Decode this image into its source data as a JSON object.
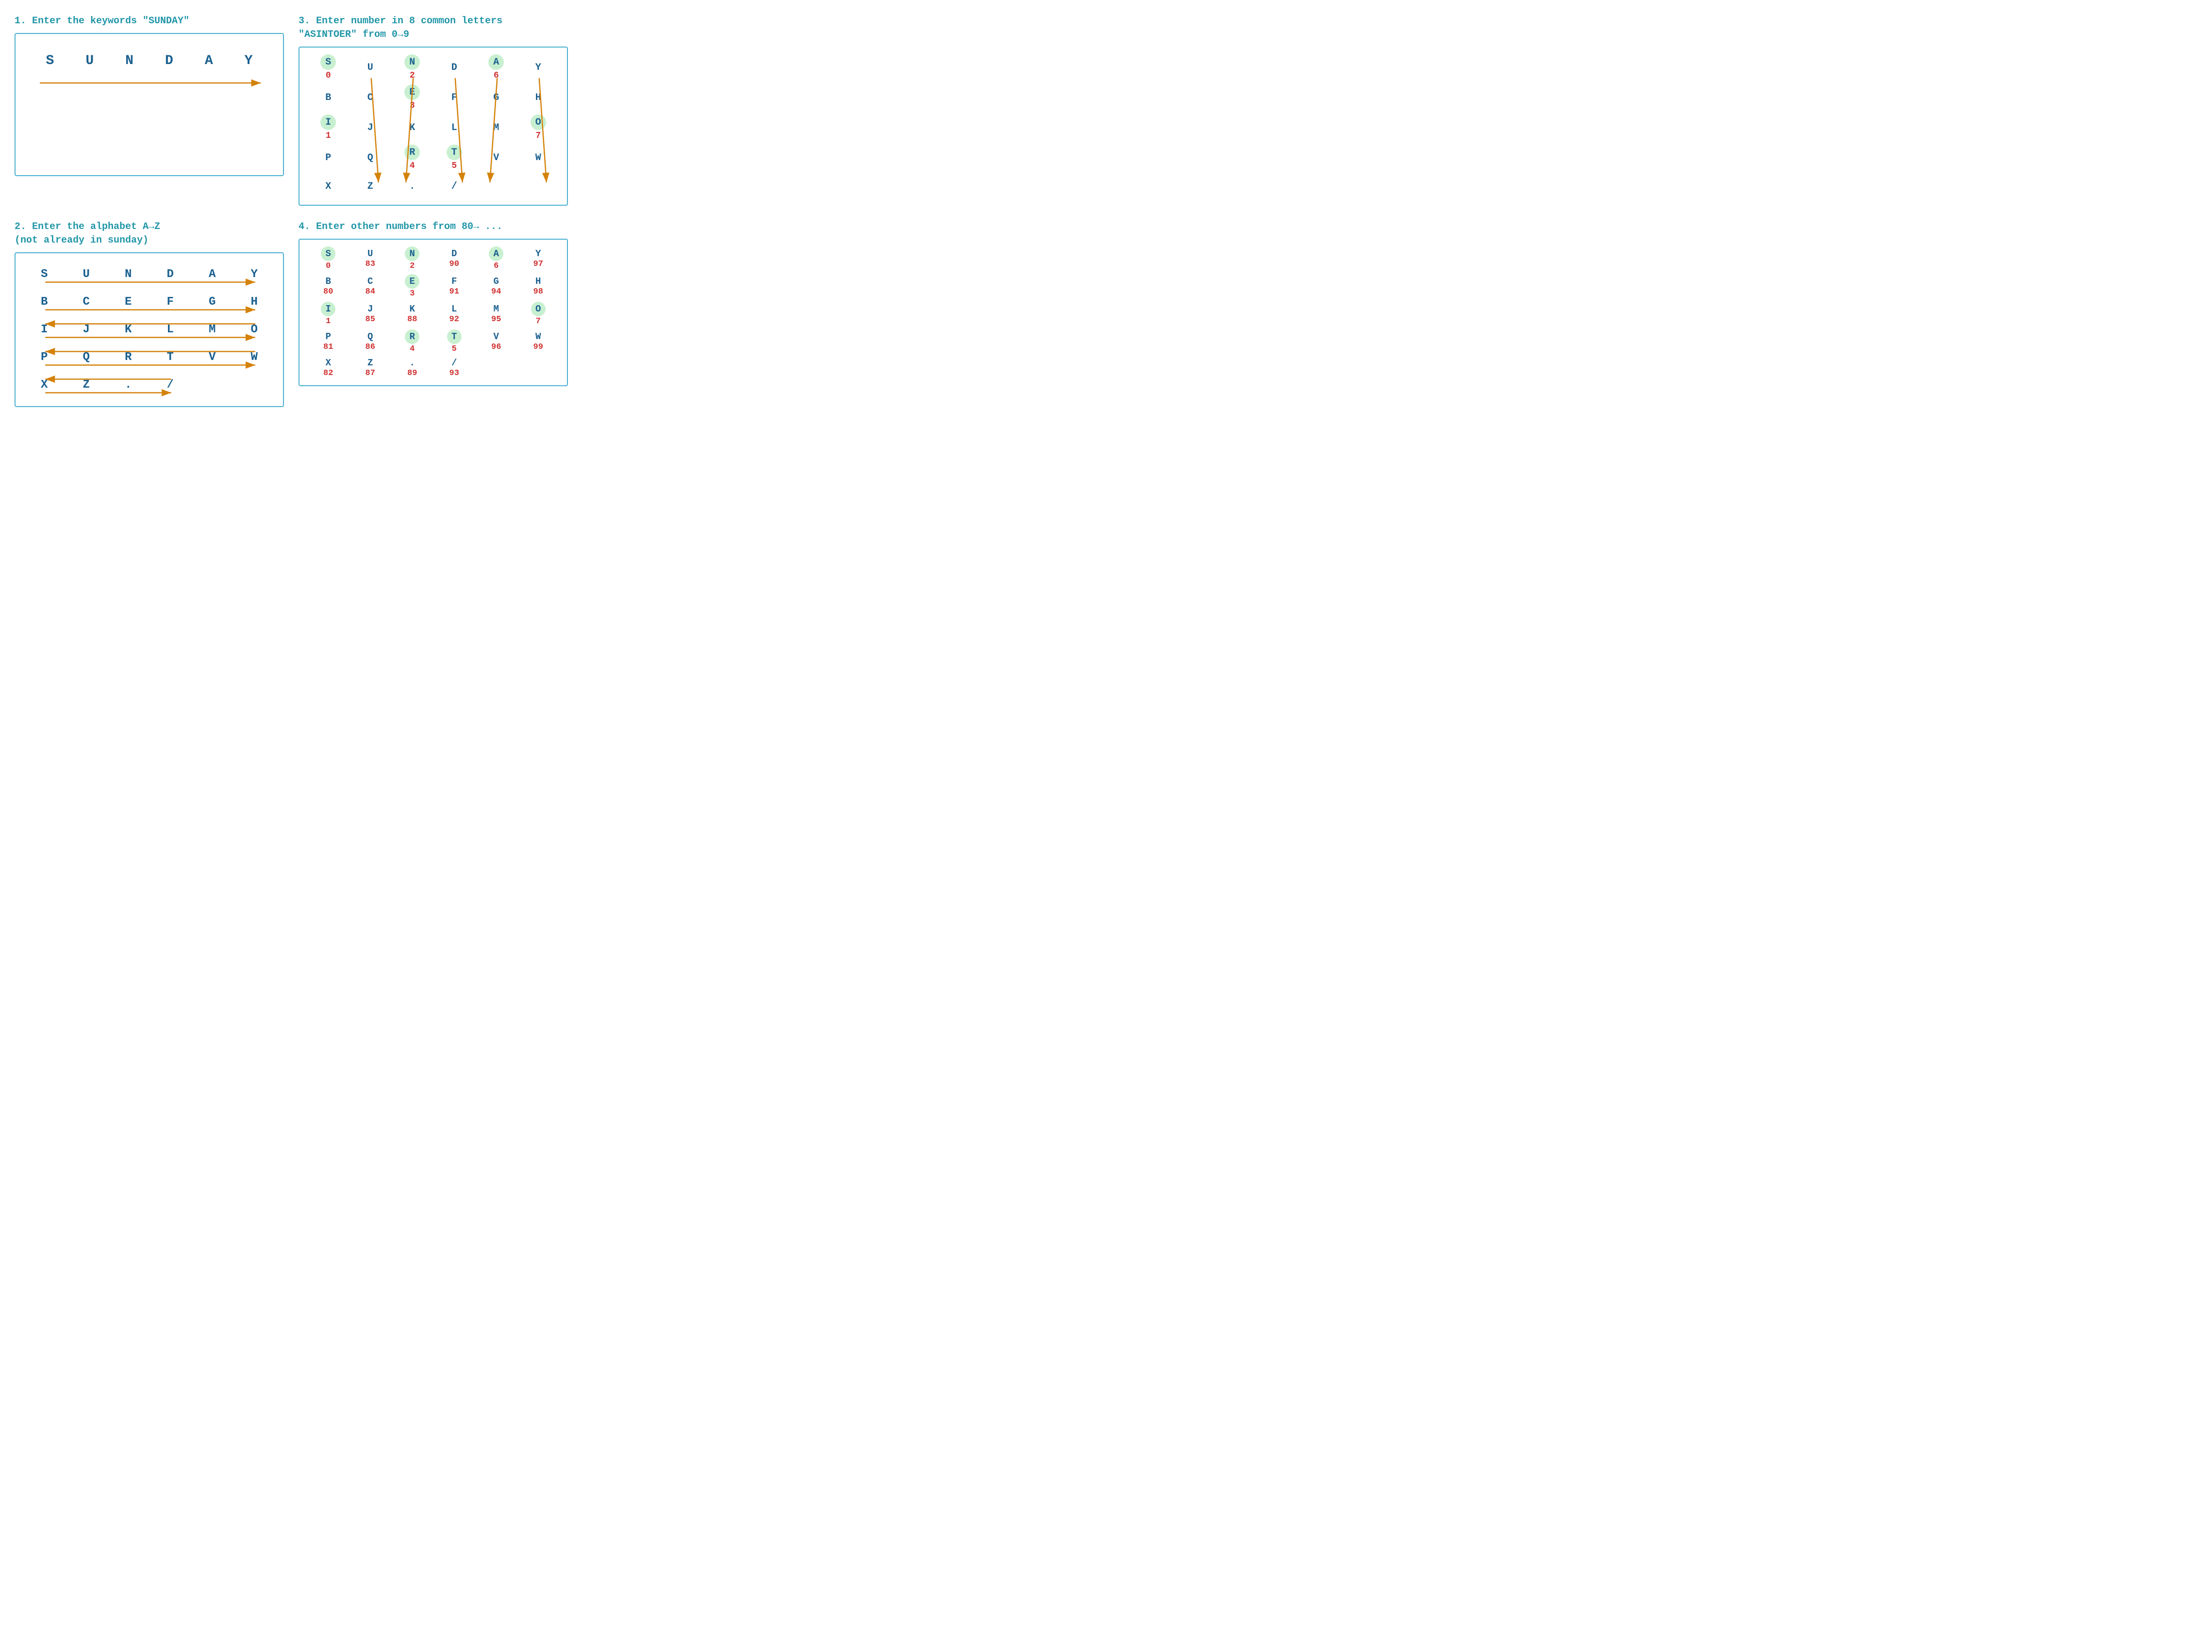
{
  "section1": {
    "title": "1. Enter the keywords \"SUNDAY\"",
    "letters": [
      "S",
      "U",
      "N",
      "D",
      "A",
      "Y"
    ]
  },
  "section2": {
    "title": "2. Enter the alphabet A→Z\n(not already in sunday)",
    "rows": [
      [
        "S",
        "U",
        "N",
        "D",
        "A",
        "Y"
      ],
      [
        "B",
        "C",
        "E",
        "F",
        "G",
        "H"
      ],
      [
        "I",
        "J",
        "K",
        "L",
        "M",
        "O"
      ],
      [
        "P",
        "Q",
        "R",
        "T",
        "V",
        "W"
      ],
      [
        "X",
        "Z",
        ".",
        "/",
        "",
        ""
      ]
    ]
  },
  "section3": {
    "title": "3. Enter number in 8 common letters\n\"ASINTOER\" from 0→9",
    "rows": [
      [
        {
          "letter": "S",
          "number": "0",
          "hl": true
        },
        {
          "letter": "U",
          "number": "",
          "hl": false
        },
        {
          "letter": "N",
          "number": "2",
          "hl": true
        },
        {
          "letter": "D",
          "number": "",
          "hl": false
        },
        {
          "letter": "A",
          "number": "6",
          "hl": true
        },
        {
          "letter": "Y",
          "number": "",
          "hl": false
        }
      ],
      [
        {
          "letter": "B",
          "number": "",
          "hl": false
        },
        {
          "letter": "C",
          "number": "",
          "hl": false
        },
        {
          "letter": "E",
          "number": "3",
          "hl": true
        },
        {
          "letter": "F",
          "number": "",
          "hl": false
        },
        {
          "letter": "G",
          "number": "",
          "hl": false
        },
        {
          "letter": "H",
          "number": "",
          "hl": false
        }
      ],
      [
        {
          "letter": "I",
          "number": "1",
          "hl": true
        },
        {
          "letter": "J",
          "number": "",
          "hl": false
        },
        {
          "letter": "K",
          "number": "",
          "hl": false
        },
        {
          "letter": "L",
          "number": "",
          "hl": false
        },
        {
          "letter": "M",
          "number": "",
          "hl": false
        },
        {
          "letter": "O",
          "number": "7",
          "hl": true
        }
      ],
      [
        {
          "letter": "P",
          "number": "",
          "hl": false
        },
        {
          "letter": "Q",
          "number": "",
          "hl": false
        },
        {
          "letter": "R",
          "number": "4",
          "hl": true
        },
        {
          "letter": "T",
          "number": "5",
          "hl": true
        },
        {
          "letter": "V",
          "number": "",
          "hl": false
        },
        {
          "letter": "W",
          "number": "",
          "hl": false
        }
      ],
      [
        {
          "letter": "X",
          "number": "",
          "hl": false
        },
        {
          "letter": "Z",
          "number": "",
          "hl": false
        },
        {
          "letter": ".",
          "number": "",
          "hl": false
        },
        {
          "letter": "/",
          "number": "",
          "hl": false
        },
        {
          "letter": "",
          "number": "",
          "hl": false
        },
        {
          "letter": "",
          "number": "",
          "hl": false
        }
      ]
    ]
  },
  "section4": {
    "title": "4. Enter other numbers from 80→ ...",
    "rows": [
      [
        {
          "letter": "S",
          "number": "0",
          "hl": true
        },
        {
          "letter": "U",
          "number": "83",
          "hl": false
        },
        {
          "letter": "N",
          "number": "2",
          "hl": true
        },
        {
          "letter": "D",
          "number": "90",
          "hl": false
        },
        {
          "letter": "A",
          "number": "6",
          "hl": true
        },
        {
          "letter": "Y",
          "number": "97",
          "hl": false
        }
      ],
      [
        {
          "letter": "B",
          "number": "80",
          "hl": false
        },
        {
          "letter": "C",
          "number": "84",
          "hl": false
        },
        {
          "letter": "E",
          "number": "3",
          "hl": true
        },
        {
          "letter": "F",
          "number": "91",
          "hl": false
        },
        {
          "letter": "G",
          "number": "94",
          "hl": false
        },
        {
          "letter": "H",
          "number": "98",
          "hl": false
        }
      ],
      [
        {
          "letter": "I",
          "number": "1",
          "hl": true
        },
        {
          "letter": "J",
          "number": "85",
          "hl": false
        },
        {
          "letter": "K",
          "number": "88",
          "hl": false
        },
        {
          "letter": "L",
          "number": "92",
          "hl": false
        },
        {
          "letter": "M",
          "number": "95",
          "hl": false
        },
        {
          "letter": "O",
          "number": "7",
          "hl": true
        }
      ],
      [
        {
          "letter": "P",
          "number": "81",
          "hl": false
        },
        {
          "letter": "Q",
          "number": "86",
          "hl": false
        },
        {
          "letter": "R",
          "number": "4",
          "hl": true
        },
        {
          "letter": "T",
          "number": "5",
          "hl": true
        },
        {
          "letter": "V",
          "number": "96",
          "hl": false
        },
        {
          "letter": "W",
          "number": "99",
          "hl": false
        }
      ],
      [
        {
          "letter": "X",
          "number": "82",
          "hl": false
        },
        {
          "letter": "Z",
          "number": "87",
          "hl": false
        },
        {
          "letter": ".",
          "number": "89",
          "hl": false
        },
        {
          "letter": "/",
          "number": "93",
          "hl": false
        },
        {
          "letter": "",
          "number": "",
          "hl": false
        },
        {
          "letter": "",
          "number": "",
          "hl": false
        }
      ]
    ]
  }
}
